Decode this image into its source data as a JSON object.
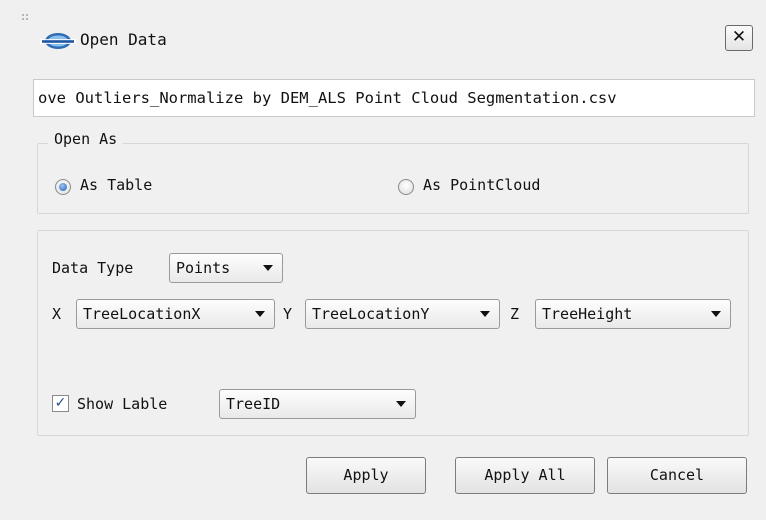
{
  "window": {
    "title": "Open Data",
    "logo_icon": "app-logo-icon",
    "close_label": "✕"
  },
  "file_path": "ove Outliers_Normalize by DEM_ALS Point Cloud Segmentation.csv",
  "open_as": {
    "group_title": "Open As",
    "options": [
      {
        "label": "As Table",
        "selected": true
      },
      {
        "label": "As PointCloud",
        "selected": false
      }
    ]
  },
  "data_settings": {
    "data_type_label": "Data Type",
    "data_type_value": "Points",
    "x_label": "X",
    "x_value": "TreeLocationX",
    "y_label": "Y",
    "y_value": "TreeLocationY",
    "z_label": "Z",
    "z_value": "TreeHeight",
    "show_label_text": "Show Lable",
    "show_label_checked": true,
    "show_label_value": "TreeID"
  },
  "buttons": {
    "apply": "Apply",
    "apply_all": "Apply All",
    "cancel": "Cancel"
  },
  "colors": {
    "background": "#f0f0f0",
    "accent": "#1e5fb8",
    "checkmark": "#2a4e88"
  }
}
